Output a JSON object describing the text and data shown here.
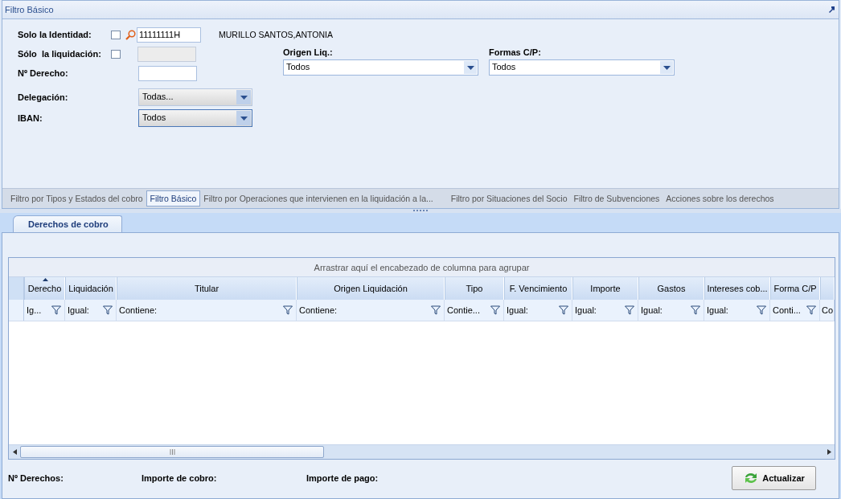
{
  "panel": {
    "title": "Filtro Básico"
  },
  "filters": {
    "identity": {
      "label": "Solo la Identidad:",
      "checked": false,
      "value": "11111111H",
      "holder_name": "MURILLO SANTOS,ANTONIA"
    },
    "liquidation": {
      "label": "Sólo  la liquidación:",
      "checked": false,
      "disabled": true
    },
    "derecho": {
      "label": "Nº Derecho:"
    },
    "delegacion": {
      "label": "Delegación:",
      "value": "Todas...",
      "focused": false
    },
    "iban": {
      "label": "IBAN:",
      "value": "Todos",
      "focused": true
    },
    "origen": {
      "label": "Origen Liq.:",
      "value": "Todos"
    },
    "formas": {
      "label": "Formas C/P:",
      "value": "Todos"
    }
  },
  "tabs": [
    {
      "label": "Filtro por Tipos y Estados del cobro",
      "selected": false
    },
    {
      "label": "Filtro Básico",
      "selected": true
    },
    {
      "label": "Filtro por Operaciones que intervienen en la liquidación a la...",
      "selected": false
    },
    {
      "label": "Filtro por Situaciones del Socio",
      "selected": false
    },
    {
      "label": "Filtro de Subvenciones",
      "selected": false
    },
    {
      "label": "Acciones sobre los derechos",
      "selected": false
    }
  ],
  "content_tabs": [
    {
      "label": "Derechos de cobro",
      "selected": true
    }
  ],
  "grid": {
    "group_hint": "Arrastrar aquí el encabezado de columna para agrupar",
    "columns": [
      {
        "header": "Derecho",
        "sorted": true,
        "filter": "Ig..."
      },
      {
        "header": "Liquidación",
        "sorted": false,
        "filter": "Igual:"
      },
      {
        "header": "Titular",
        "sorted": false,
        "filter": "Contiene:"
      },
      {
        "header": "Origen Liquidación",
        "sorted": false,
        "filter": "Contiene:"
      },
      {
        "header": "Tipo",
        "sorted": false,
        "filter": "Contie..."
      },
      {
        "header": "F. Vencimiento",
        "sorted": false,
        "filter": "Igual:"
      },
      {
        "header": "Importe",
        "sorted": false,
        "filter": "Igual:"
      },
      {
        "header": "Gastos",
        "sorted": false,
        "filter": "Igual:"
      },
      {
        "header": "Intereses cob...",
        "sorted": false,
        "filter": "Igual:"
      },
      {
        "header": "Forma C/P",
        "sorted": false,
        "filter": "Conti..."
      },
      {
        "sorted": false,
        "filter": "Co"
      }
    ]
  },
  "footer": {
    "totals": [
      "Nº Derechos:",
      "Importe de cobro:",
      "Importe de pago:"
    ],
    "button": "Actualizar"
  }
}
